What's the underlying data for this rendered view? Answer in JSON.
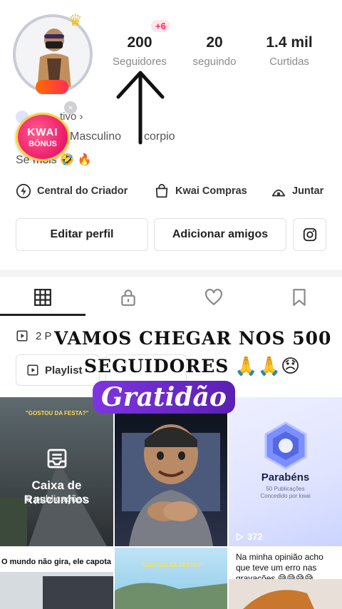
{
  "stats": {
    "followers_value": "200",
    "followers_label": "Seguidores",
    "following_value": "20",
    "following_label": "seguindo",
    "likes_value": "1.4 mil",
    "likes_label": "Curtidas",
    "new_followers_badge": "+6"
  },
  "profile": {
    "tag_text": "tivo",
    "gender": "Masculino",
    "sign": "corpio",
    "bio": "Se   mois"
  },
  "bonus": {
    "line1": "KWAI",
    "line2": "BÔNUS"
  },
  "shortcuts": {
    "creator": "Central do Criador",
    "shop": "Kwai Compras",
    "join": "Juntar"
  },
  "buttons": {
    "edit_profile": "Editar perfil",
    "add_friends": "Adicionar amigos"
  },
  "collection": {
    "count_label": "2 P",
    "playlist_label": "Playlist"
  },
  "overlay": {
    "line1": "VAMOS  CHEGAR NOS 500",
    "line2": "SEGUIDORES",
    "emojis": "🙏🙏😞",
    "gratitude": "Gratidão"
  },
  "grid": {
    "drafts_title": "Caixa de Rascunhos",
    "drafts_count": "6 publicações",
    "cell1_top_caption": "\"GOSTOU DA FESTA?\"",
    "cell3_title": "Parabéns",
    "cell3_sub1": "50 Publicações",
    "cell3_sub2": "Concedido por kwai",
    "cell3_views": "372",
    "cell4_caption": "O mundo não gira, ele capota",
    "cell5_caption": "\"GOSTOU DA FESTA?\"",
    "cell6_caption": "Na minha opinião acho que teve um erro nas gravações 😅😅😅😅"
  },
  "colors": {
    "accent_red": "#ff2b4f",
    "overlay_purple": "#6a28c8",
    "badge_gradient_start": "#ff6b00"
  },
  "icons": [
    "crown-icon",
    "tag-icon",
    "bonus-close-icon",
    "creator-icon",
    "shop-bag-icon",
    "join-icon",
    "instagram-icon",
    "grid-icon",
    "lock-icon",
    "heart-icon",
    "bookmark-icon",
    "playlist-icon",
    "chevron-up-icon",
    "play-icon",
    "arrow-up-icon",
    "drafts-icon"
  ]
}
